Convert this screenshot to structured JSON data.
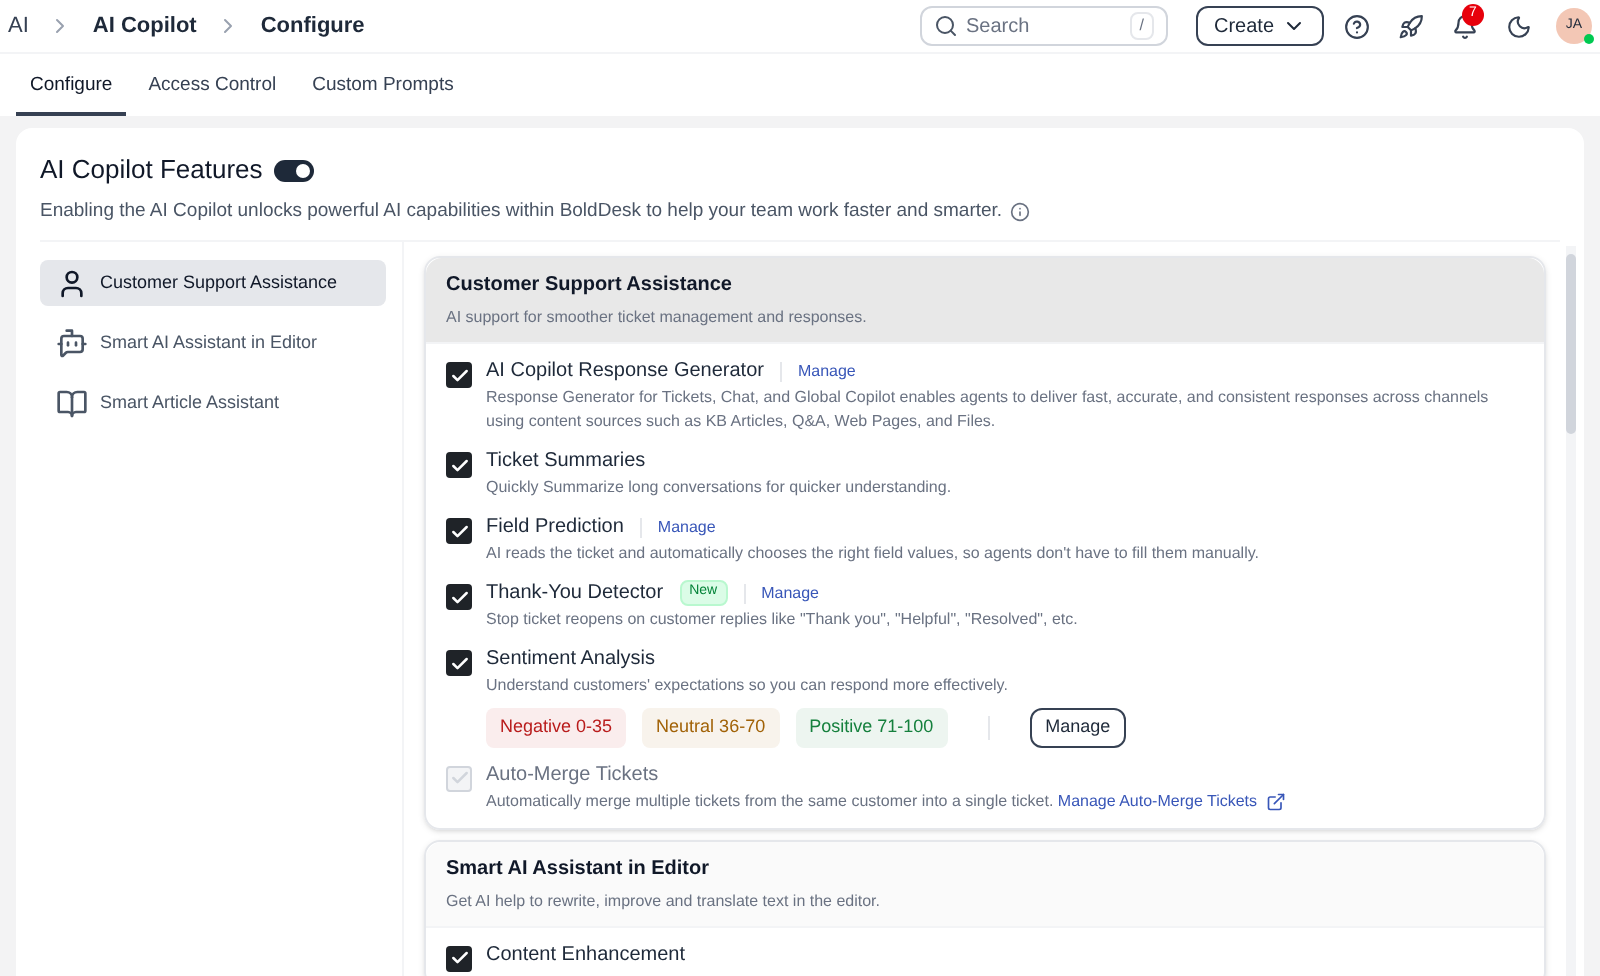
{
  "breadcrumb": [
    "AI",
    "AI Copilot",
    "Configure"
  ],
  "search": {
    "placeholder": "Search",
    "shortcut": "/"
  },
  "create_button": "Create",
  "notifications": {
    "count": "7"
  },
  "avatar": {
    "initials": "JA",
    "online": true
  },
  "tabs": [
    {
      "label": "Configure",
      "selected": true
    },
    {
      "label": "Access Control",
      "selected": false
    },
    {
      "label": "Custom Prompts",
      "selected": false
    }
  ],
  "features": {
    "title": "AI Copilot Features",
    "enabled": true,
    "description": "Enabling the AI Copilot unlocks powerful AI capabilities within BoldDesk to help your team work faster and smarter."
  },
  "sidebar": {
    "items": [
      {
        "label": "Customer Support Assistance",
        "kind": "person",
        "selected": true
      },
      {
        "label": "Smart AI Assistant in Editor",
        "kind": "ai",
        "selected": false
      },
      {
        "label": "Smart Article Assistant",
        "kind": "book",
        "selected": false
      }
    ]
  },
  "sections": [
    {
      "title": "Customer Support Assistance",
      "subtitle": "AI support for smoother ticket management and responses.",
      "highlighted": true,
      "items": [
        {
          "kind": "basic",
          "title": "AI Copilot Response Generator",
          "checked": true,
          "disabled": false,
          "manage": "Manage",
          "description": "Response Generator for Tickets, Chat, and Global Copilot enables agents to deliver fast, accurate, and consistent responses across channels using content sources such as KB Articles, Q&A, Web Pages, and Files."
        },
        {
          "kind": "basic",
          "title": "Ticket Summaries",
          "checked": true,
          "disabled": false,
          "description": "Quickly Summarize long conversations for quicker understanding."
        },
        {
          "kind": "basic",
          "title": "Field Prediction",
          "checked": true,
          "disabled": false,
          "manage": "Manage",
          "description": "AI reads the ticket and automatically chooses the right field values, so agents don't have to fill them manually."
        },
        {
          "kind": "basic",
          "title": "Thank-You Detector",
          "checked": true,
          "disabled": false,
          "badge": "New",
          "manage": "Manage",
          "description": "Stop ticket reopens on customer replies like \"Thank you\", \"Helpful\", \"Resolved\", etc."
        },
        {
          "kind": "sentiment",
          "title": "Sentiment Analysis",
          "checked": true,
          "disabled": false,
          "description": "Understand customers' expectations so you can respond more effectively.",
          "ranges": [
            {
              "label": "Negative 0-35",
              "color": "#b91c1c"
            },
            {
              "label": "Neutral 36-70",
              "color": "#a16207"
            },
            {
              "label": "Positive 71-100",
              "color": "#15803d"
            }
          ],
          "manage_button": "Manage"
        },
        {
          "kind": "basic",
          "title": "Auto-Merge Tickets",
          "checked": true,
          "disabled": true,
          "description": "Automatically merge multiple tickets from the same customer into a single ticket.",
          "link": "Manage Auto-Merge Tickets"
        }
      ]
    },
    {
      "title": "Smart AI Assistant in Editor",
      "subtitle": "Get AI help to rewrite, improve and translate text in the editor.",
      "highlighted": false,
      "items": [
        {
          "kind": "basic",
          "title": "Content Enhancement",
          "checked": true,
          "disabled": false
        }
      ]
    }
  ]
}
